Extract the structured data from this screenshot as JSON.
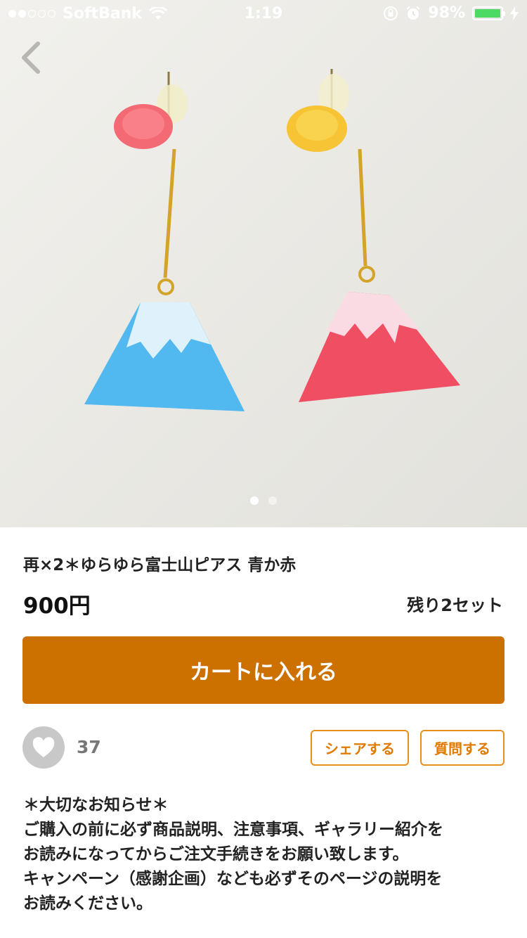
{
  "status_bar": {
    "carrier": "SoftBank",
    "time": "1:19",
    "battery_percent": "98%",
    "signal_bars": 2,
    "signal_total": 5
  },
  "gallery": {
    "image_count": 2,
    "active_index": 0
  },
  "product": {
    "title": "再×2＊ゆらゆら富士山ピアス 青か赤",
    "price": "900円",
    "stock": "残り2セット"
  },
  "actions": {
    "cart_label": "カートに入れる",
    "like_count": "37",
    "share_label": "シェアする",
    "question_label": "質問する"
  },
  "notice": {
    "lines": [
      "＊大切なお知らせ＊",
      "ご購入の前に必ず商品説明、注意事項、ギャラリー紹介を",
      "お読みになってからご注文手続きをお願い致します。",
      "キャンペーン（感謝企画）なども必ずそのページの説明を",
      "お読みください。"
    ]
  },
  "colors": {
    "accent": "#cc7000",
    "outline_accent": "#e88f1a",
    "battery": "#4cd964",
    "like_bg": "#c8c8c8"
  }
}
